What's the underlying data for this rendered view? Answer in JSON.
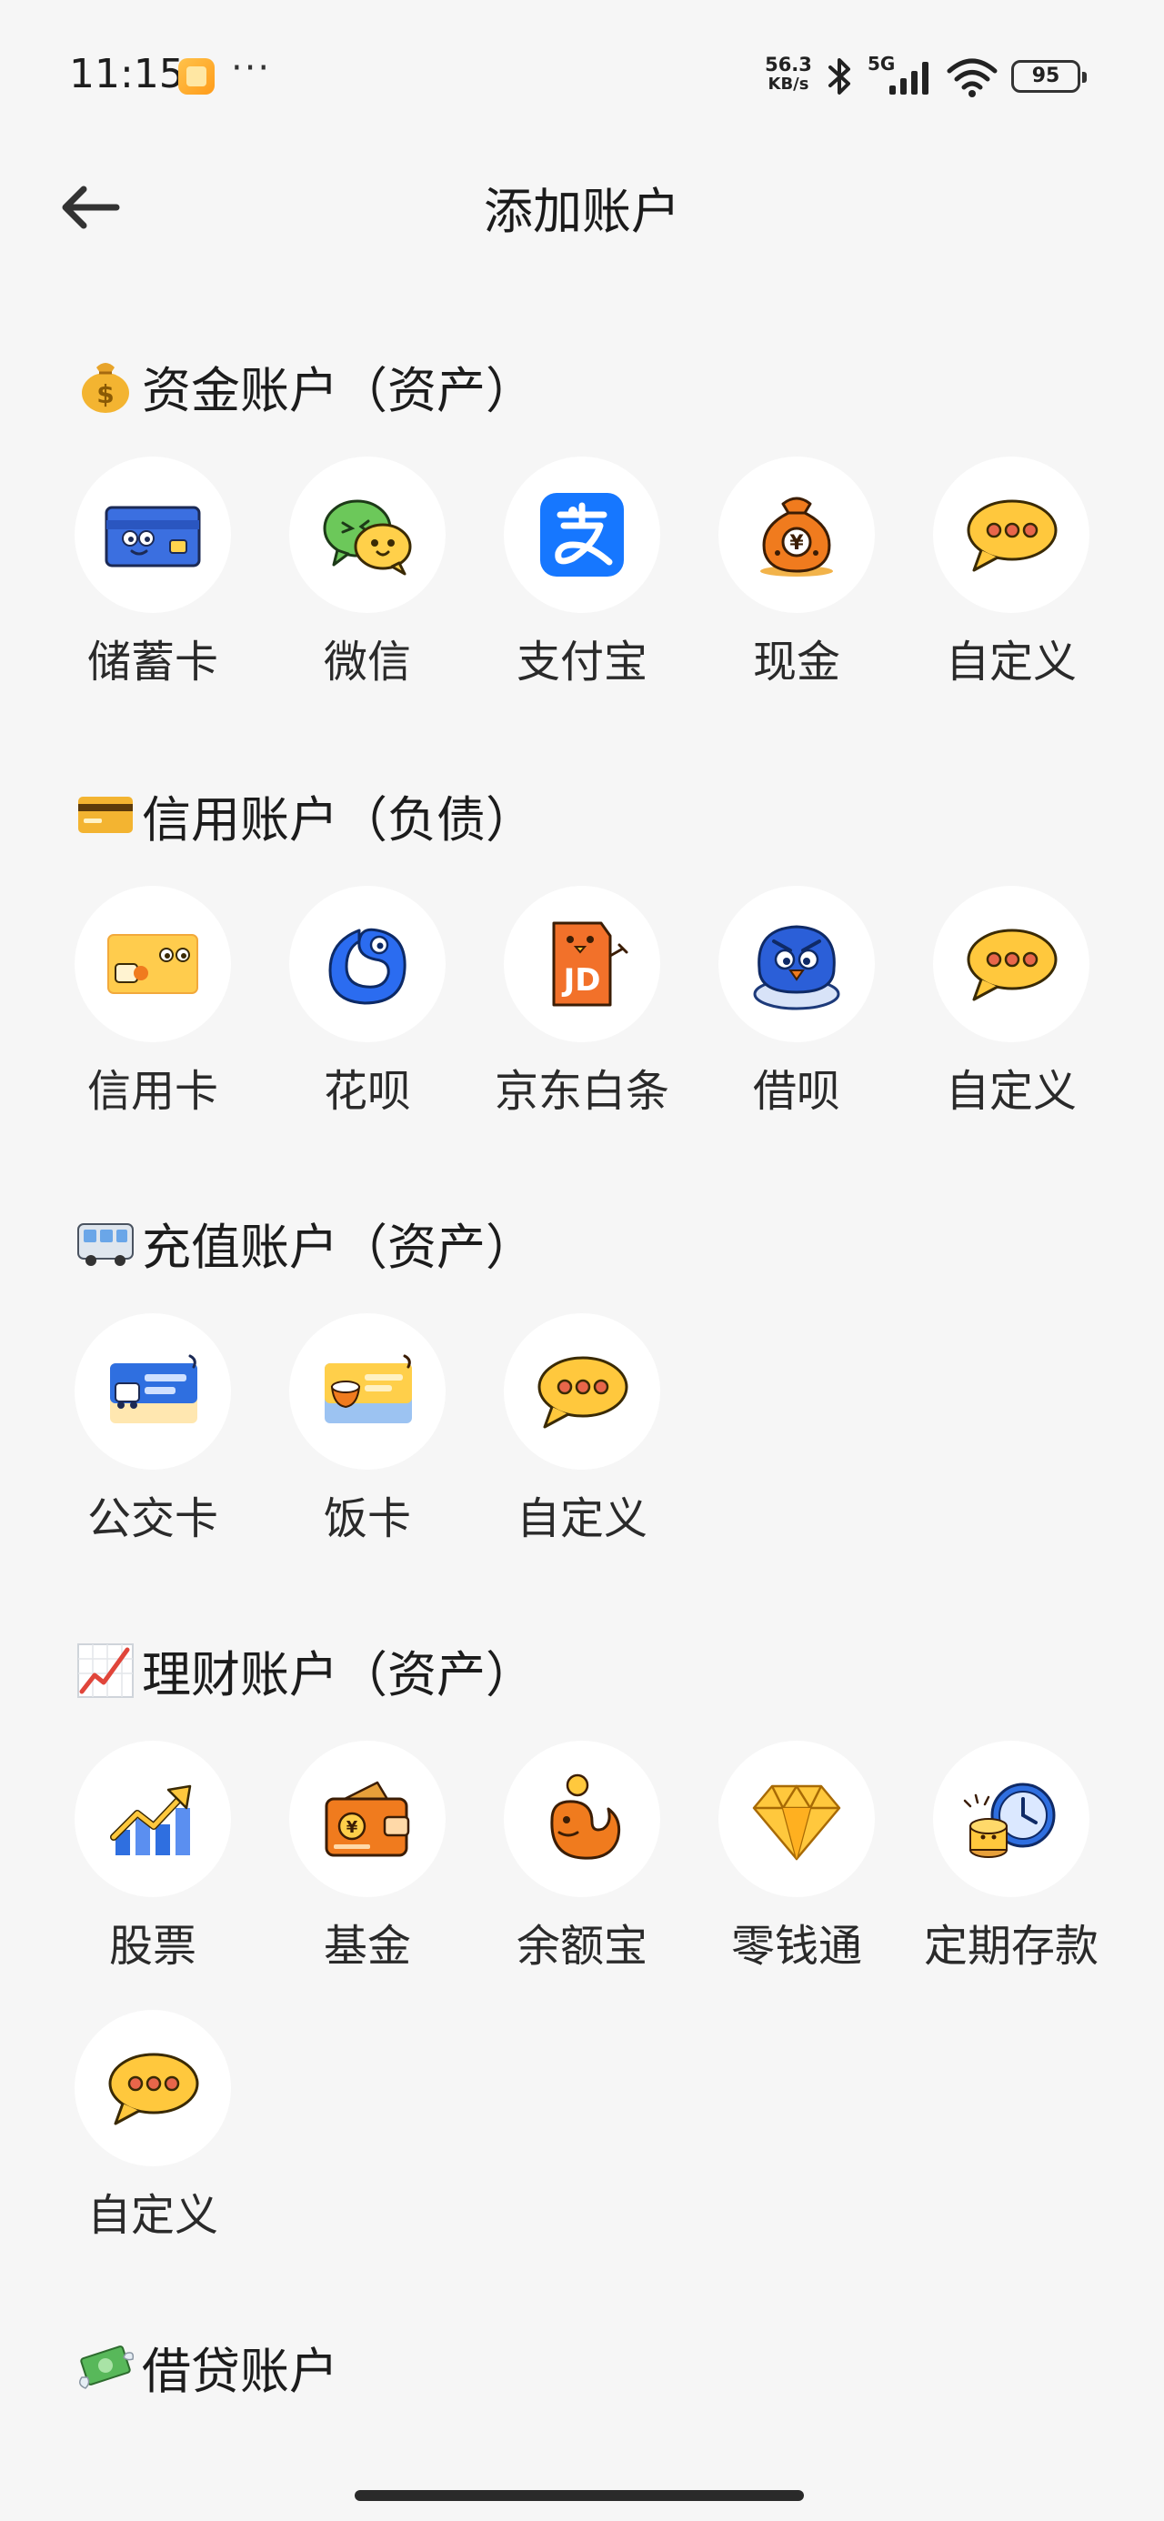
{
  "status_bar": {
    "time": "11:15",
    "more": "···",
    "speed_value": "56.3",
    "speed_unit": "KB/s",
    "network": "5G",
    "battery": "95"
  },
  "header": {
    "title": "添加账户"
  },
  "sections": [
    {
      "title": "资金账户（资产）",
      "emoji": "money-bag-icon",
      "items": [
        {
          "label": "储蓄卡",
          "icon": "debit-card-icon"
        },
        {
          "label": "微信",
          "icon": "wechat-icon"
        },
        {
          "label": "支付宝",
          "icon": "alipay-icon"
        },
        {
          "label": "现金",
          "icon": "cash-bag-icon"
        },
        {
          "label": "自定义",
          "icon": "custom-chat-icon"
        }
      ]
    },
    {
      "title": "信用账户（负债）",
      "emoji": "credit-card-emoji-icon",
      "items": [
        {
          "label": "信用卡",
          "icon": "credit-card-icon"
        },
        {
          "label": "花呗",
          "icon": "huabei-icon"
        },
        {
          "label": "京东白条",
          "icon": "jd-baitiao-icon"
        },
        {
          "label": "借呗",
          "icon": "jiebei-icon"
        },
        {
          "label": "自定义",
          "icon": "custom-chat-icon"
        }
      ]
    },
    {
      "title": "充值账户（资产）",
      "emoji": "bus-icon",
      "items": [
        {
          "label": "公交卡",
          "icon": "bus-card-icon"
        },
        {
          "label": "饭卡",
          "icon": "meal-card-icon"
        },
        {
          "label": "自定义",
          "icon": "custom-chat-icon"
        }
      ]
    },
    {
      "title": "理财账户（资产）",
      "emoji": "chart-increasing-icon",
      "items": [
        {
          "label": "股票",
          "icon": "stock-icon"
        },
        {
          "label": "基金",
          "icon": "fund-wallet-icon"
        },
        {
          "label": "余额宝",
          "icon": "yuebao-icon"
        },
        {
          "label": "零钱通",
          "icon": "lingqiantong-diamond-icon"
        },
        {
          "label": "定期存款",
          "icon": "fixed-deposit-icon"
        },
        {
          "label": "自定义",
          "icon": "custom-chat-icon"
        }
      ]
    },
    {
      "title": "借贷账户",
      "emoji": "money-with-wings-icon",
      "items": []
    }
  ],
  "colors": {
    "background": "#f6f6f6",
    "tile_background": "#ffffff",
    "accent_yellow": "#ffc83d",
    "alipay_blue": "#1677ff",
    "wechat_green": "#62c462"
  }
}
